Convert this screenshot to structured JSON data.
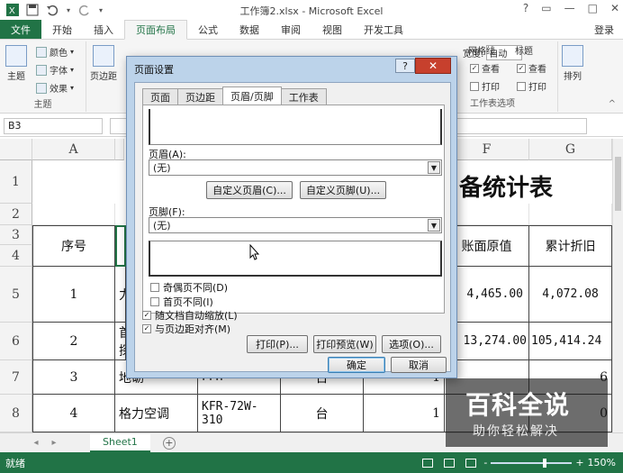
{
  "window": {
    "title": "工作簿2.xlsx - Microsoft Excel",
    "controls": [
      "?",
      "▭",
      "—",
      "□",
      "✕"
    ]
  },
  "ribbon_tabs": {
    "file": "文件",
    "items": [
      "开始",
      "插入",
      "页面布局",
      "公式",
      "数据",
      "审阅",
      "视图",
      "开发工具"
    ],
    "active": "页面布局",
    "login": "登录"
  },
  "ribbon": {
    "theme": {
      "big": "主题",
      "colors": "颜色",
      "fonts": "字体",
      "effects": "效果",
      "group": "主题"
    },
    "margins": "页边距",
    "width_label": "宽度:",
    "width_value": "自动",
    "gridlines": {
      "title": "网格线",
      "view": "查看",
      "print": "打印"
    },
    "headings": {
      "title": "标题",
      "view": "查看",
      "print": "打印"
    },
    "sheet_options": "工作表选项",
    "arrange": "排列"
  },
  "formula_bar": {
    "name_box": "B3"
  },
  "grid": {
    "columns": [
      "A",
      "F",
      "G"
    ],
    "rows": [
      "1",
      "2",
      "3",
      "4",
      "5",
      "6",
      "7",
      "8"
    ],
    "title_fragment": "备统计表",
    "header_seq": "序号",
    "header_f": "账面原值",
    "header_g": "累计折旧",
    "r5": {
      "a": "1",
      "b": "力",
      "f": "4,465.00",
      "g": "4,072.08"
    },
    "r6": {
      "a": "2",
      "b1": "首",
      "b2": "探",
      "f": "13,274.00",
      "g": "105,414.24"
    },
    "r7": {
      "a": "3",
      "b": "地砺",
      "c": "FFH",
      "d": "台",
      "e": "1",
      "g": "6"
    },
    "r8": {
      "a": "4",
      "b": "格力空调",
      "c1": "KFR-72W-",
      "c2": "310",
      "d": "台",
      "e": "1",
      "g": "0"
    }
  },
  "sheet_tabs": {
    "active": "Sheet1",
    "add": "+"
  },
  "status_bar": {
    "ready": "就绪",
    "zoom": "150%",
    "minus": "-",
    "plus": "+"
  },
  "dialog": {
    "title": "页面设置",
    "help": "?",
    "close": "✕",
    "tabs": [
      "页面",
      "页边距",
      "页眉/页脚",
      "工作表"
    ],
    "active_tab": "页眉/页脚",
    "header_label": "页眉(A):",
    "header_value": "(无)",
    "custom_header": "自定义页眉(C)...",
    "custom_footer": "自定义页脚(U)...",
    "footer_label": "页脚(F):",
    "footer_value": "(无)",
    "checks": [
      {
        "label": "奇偶页不同(D)",
        "checked": false
      },
      {
        "label": "首页不同(I)",
        "checked": false
      },
      {
        "label": "随文档自动缩放(L)",
        "checked": true
      },
      {
        "label": "与页边距对齐(M)",
        "checked": true
      }
    ],
    "print": "打印(P)...",
    "print_preview": "打印预览(W)",
    "options": "选项(O)...",
    "ok": "确定",
    "cancel": "取消"
  },
  "watermark": {
    "main": "百科全说",
    "sub": "助你轻松解决"
  },
  "colors": {
    "excel_green": "#217346",
    "dialog_frame": "#bcd3ea",
    "close_red": "#c7402d"
  }
}
